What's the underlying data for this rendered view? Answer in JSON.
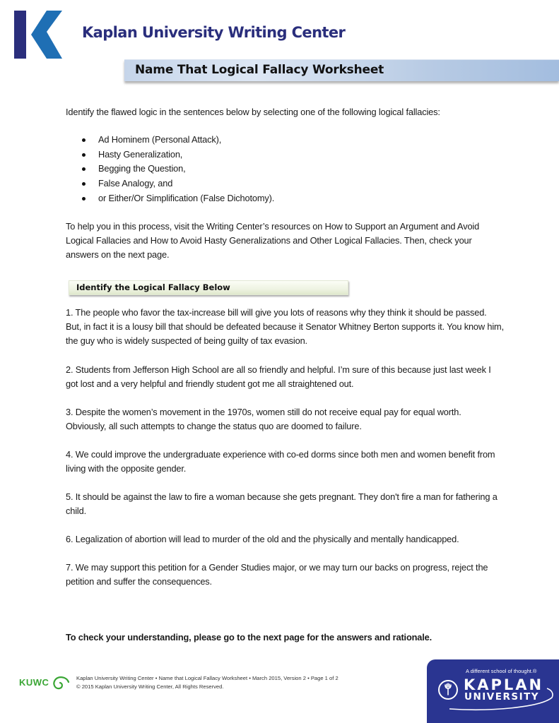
{
  "header": {
    "logo_icon": "kaplan-k-logo",
    "org_title": "Kaplan University Writing Center",
    "worksheet_title": "Name That Logical Fallacy Worksheet"
  },
  "intro": "Identify the flawed logic in the sentences below by selecting one of the following logical fallacies:",
  "fallacies": [
    "Ad Hominem (Personal Attack),",
    "Hasty Generalization,",
    "Begging the Question,",
    "False Analogy, and",
    "or Either/Or Simplification (False Dichotomy)."
  ],
  "help_text": "To help you in this process, visit the Writing Center’s resources on How to Support an Argument and Avoid Logical Fallacies and How to Avoid Hasty Generalizations and Other Logical Fallacies. Then, check your answers on the next page.",
  "section_heading": "Identify the Logical Fallacy Below",
  "questions": [
    "1. The people who favor the tax-increase bill will give you lots of reasons why they think it should be passed. But, in fact it is a lousy bill that should be defeated because it Senator Whitney Berton supports it. You know him, the guy who is widely suspected of being guilty of tax evasion.",
    "2. Students from Jefferson High School are all so friendly and helpful. I’m sure of this because just last week I got lost and a very helpful and friendly student got me all straightened out.",
    "3. Despite the women’s movement in the 1970s, women still do not receive equal pay for equal worth. Obviously, all such attempts to change the status quo are doomed to failure.",
    "4. We could improve the undergraduate experience with co-ed dorms since both men and women benefit from living with the opposite gender.",
    "5. It should be against the law to fire a woman because she gets pregnant. They don't fire a man for fathering a child.",
    "6. Legalization of abortion will lead to murder of the old and the physically and mentally handicapped.",
    "7. We may support this petition for a Gender Studies major, or we may turn our backs on progress, reject the petition and suffer the consequences."
  ],
  "closing": "To check your understanding, please go to the next page for the answers and rationale.",
  "footer": {
    "kuwc_label": "KUWC",
    "line1": "Kaplan University Writing Center  • Name that Logical Fallacy Worksheet  • March 2015, Version 2 • Page 1 of 2",
    "line2": "© 2015 Kaplan University Writing Center, All Rights Reserved.",
    "brand_tagline": "A different school of thought.®",
    "brand_name": "KAPLAN",
    "brand_sub": "UNIVERSITY"
  },
  "colors": {
    "brand_navy": "#2a2e7c",
    "brand_blue": "#1f6fb4",
    "kuwc_green": "#3aa635",
    "ku_block": "#2a3591"
  }
}
